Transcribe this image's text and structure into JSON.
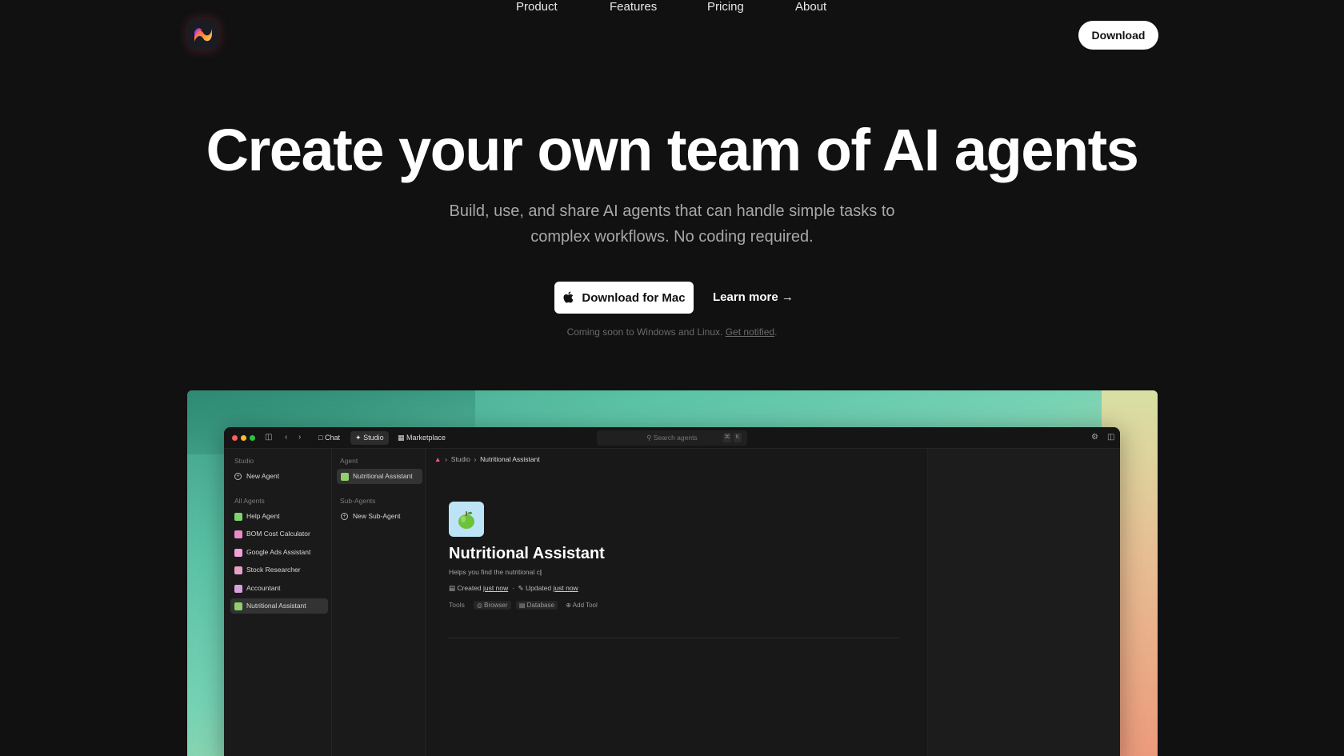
{
  "nav": {
    "links": [
      "Product",
      "Features",
      "Pricing",
      "About"
    ],
    "download_label": "Download"
  },
  "hero": {
    "title": "Create your own team of AI agents",
    "subtitle": "Build, use, and share AI agents that can handle simple tasks to complex workflows. No coding required.",
    "primary_cta": "Download for Mac",
    "secondary_cta": "Learn more →",
    "coming_soon": "Coming soon to Windows and Linux.",
    "get_notified": "Get notified",
    "coming_soon_suffix": "."
  },
  "app": {
    "tabs": [
      "Chat",
      "Studio",
      "Marketplace"
    ],
    "active_tab": "Studio",
    "search_placeholder": "Search agents",
    "shortcut_keys": [
      "⌘",
      "K"
    ],
    "sidebar": {
      "studio_label": "Studio",
      "new_agent": "New Agent",
      "all_agents_label": "All Agents",
      "agents": [
        {
          "label": "Help Agent",
          "color": "#7ed36f"
        },
        {
          "label": "BOM Cost Calculator",
          "color": "#e98bc9"
        },
        {
          "label": "Google Ads Assistant",
          "color": "#f1a0d9"
        },
        {
          "label": "Stock Researcher",
          "color": "#e7a0c8"
        },
        {
          "label": "Accountant",
          "color": "#d8a0e0"
        },
        {
          "label": "Nutritional Assistant",
          "color": "#8fcf6e"
        }
      ],
      "selected_agent": "Nutritional Assistant"
    },
    "agent_panel": {
      "agent_label": "Agent",
      "agent_item": "Nutritional Assistant",
      "sub_agents_label": "Sub-Agents",
      "new_sub_agent": "New Sub-Agent"
    },
    "main": {
      "breadcrumb": [
        "Studio",
        "Nutritional Assistant"
      ],
      "agent_name": "Nutritional Assistant",
      "description": "Helps you find the nutritional c",
      "created_label": "Created",
      "created_value": "just now",
      "updated_label": "Updated",
      "updated_value": "just now",
      "tools_label": "Tools",
      "tools": [
        "Browser",
        "Database"
      ],
      "add_tool": "Add Tool"
    }
  },
  "colors": {
    "background": "#111111",
    "accent_white": "#ffffff",
    "muted_text": "#a8a8a8"
  }
}
